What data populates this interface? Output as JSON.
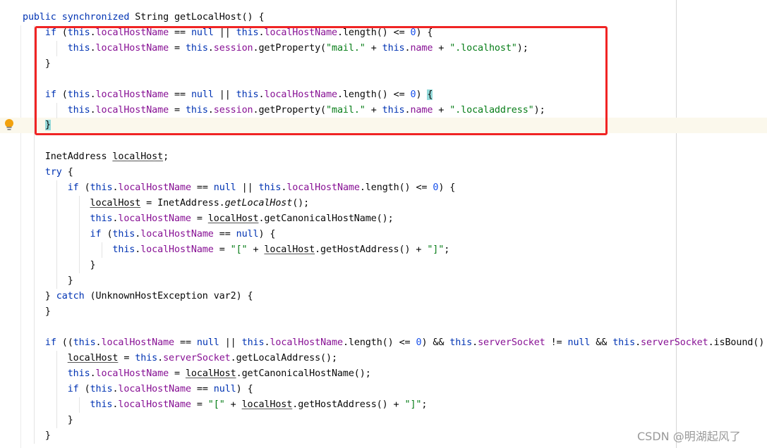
{
  "editor": {
    "highlighted_line_index": 7,
    "highlighted_region": {
      "label": "red-annotation-box",
      "from_line": 1,
      "to_line": 7
    },
    "intention_icon": "lightbulb-icon",
    "lines": [
      "public synchronized String getLocalHost() {",
      "    if (this.localHostName == null || this.localHostName.length() <= 0) {",
      "        this.localHostName = this.session.getProperty(\"mail.\" + this.name + \".localhost\");",
      "    }",
      "",
      "    if (this.localHostName == null || this.localHostName.length() <= 0) {",
      "        this.localHostName = this.session.getProperty(\"mail.\" + this.name + \".localaddress\");",
      "    }",
      "",
      "    InetAddress localHost;",
      "    try {",
      "        if (this.localHostName == null || this.localHostName.length() <= 0) {",
      "            localHost = InetAddress.getLocalHost();",
      "            this.localHostName = localHost.getCanonicalHostName();",
      "            if (this.localHostName == null) {",
      "                this.localHostName = \"[\" + localHost.getHostAddress() + \"]\";",
      "            }",
      "        }",
      "    } catch (UnknownHostException var2) {",
      "    }",
      "",
      "    if ((this.localHostName == null || this.localHostName.length() <= 0) && this.serverSocket != null && this.serverSocket.isBound()",
      "        localHost = this.serverSocket.getLocalAddress();",
      "        this.localHostName = localHost.getCanonicalHostName();",
      "        if (this.localHostName == null) {",
      "            this.localHostName = \"[\" + localHost.getHostAddress() + \"]\";",
      "        }",
      "    }"
    ]
  },
  "tokens": {
    "kw_public": "public",
    "kw_synchronized": "synchronized",
    "kw_if": "if",
    "kw_this": "this",
    "kw_null": "null",
    "kw_try": "try",
    "kw_catch": "catch",
    "num_zero": "0",
    "f_localHostName": "localHostName",
    "f_session": "session",
    "f_name": "name",
    "f_serverSocket": "serverSocket",
    "s_mail": "\"mail.\"",
    "s_localhost": "\".localhost\"",
    "s_localaddress": "\".localaddress\"",
    "s_lbr": "\"[\"",
    "s_rbr": "\"]\"",
    "v_localHost": "localHost",
    "m_getLocalHost_static": "getLocalHost"
  },
  "watermark": "CSDN @明湖起风了",
  "colors": {
    "keyword": "#0033b3",
    "field": "#871094",
    "string": "#067d17",
    "number": "#1750eb",
    "text": "#080808",
    "current_line": "#fbf8ec",
    "annotation_box": "#f02424",
    "brace_match": "#93d9d9"
  }
}
